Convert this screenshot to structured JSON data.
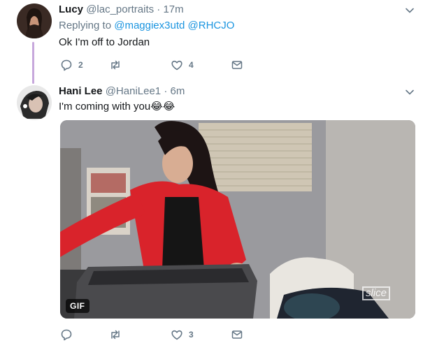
{
  "tweet1": {
    "name": "Lucy",
    "handle": "@lac_portraits",
    "separator": "·",
    "time": "17m",
    "reply_prefix": "Replying to",
    "reply_mentions": [
      "@maggiex3utd",
      "@RHCJO"
    ],
    "text": "Ok I'm off to Jordan",
    "counts": {
      "reply": "2",
      "retweet": "",
      "like": "4"
    }
  },
  "tweet2": {
    "name": "Hani Lee",
    "handle": "@HaniLee1",
    "separator": "·",
    "time": "6m",
    "text": "I'm coming with you😂😂",
    "counts": {
      "reply": "",
      "retweet": "",
      "like": "3"
    },
    "media": {
      "badge": "GIF",
      "watermark": "slice"
    }
  },
  "icons": [
    "reply-icon",
    "retweet-icon",
    "like-icon",
    "dm-icon",
    "chevron-down-icon"
  ],
  "colors": {
    "link": "#1b95e0",
    "muted": "#657786",
    "thread": "#c7a8dc",
    "blazer": "#d9232b"
  }
}
